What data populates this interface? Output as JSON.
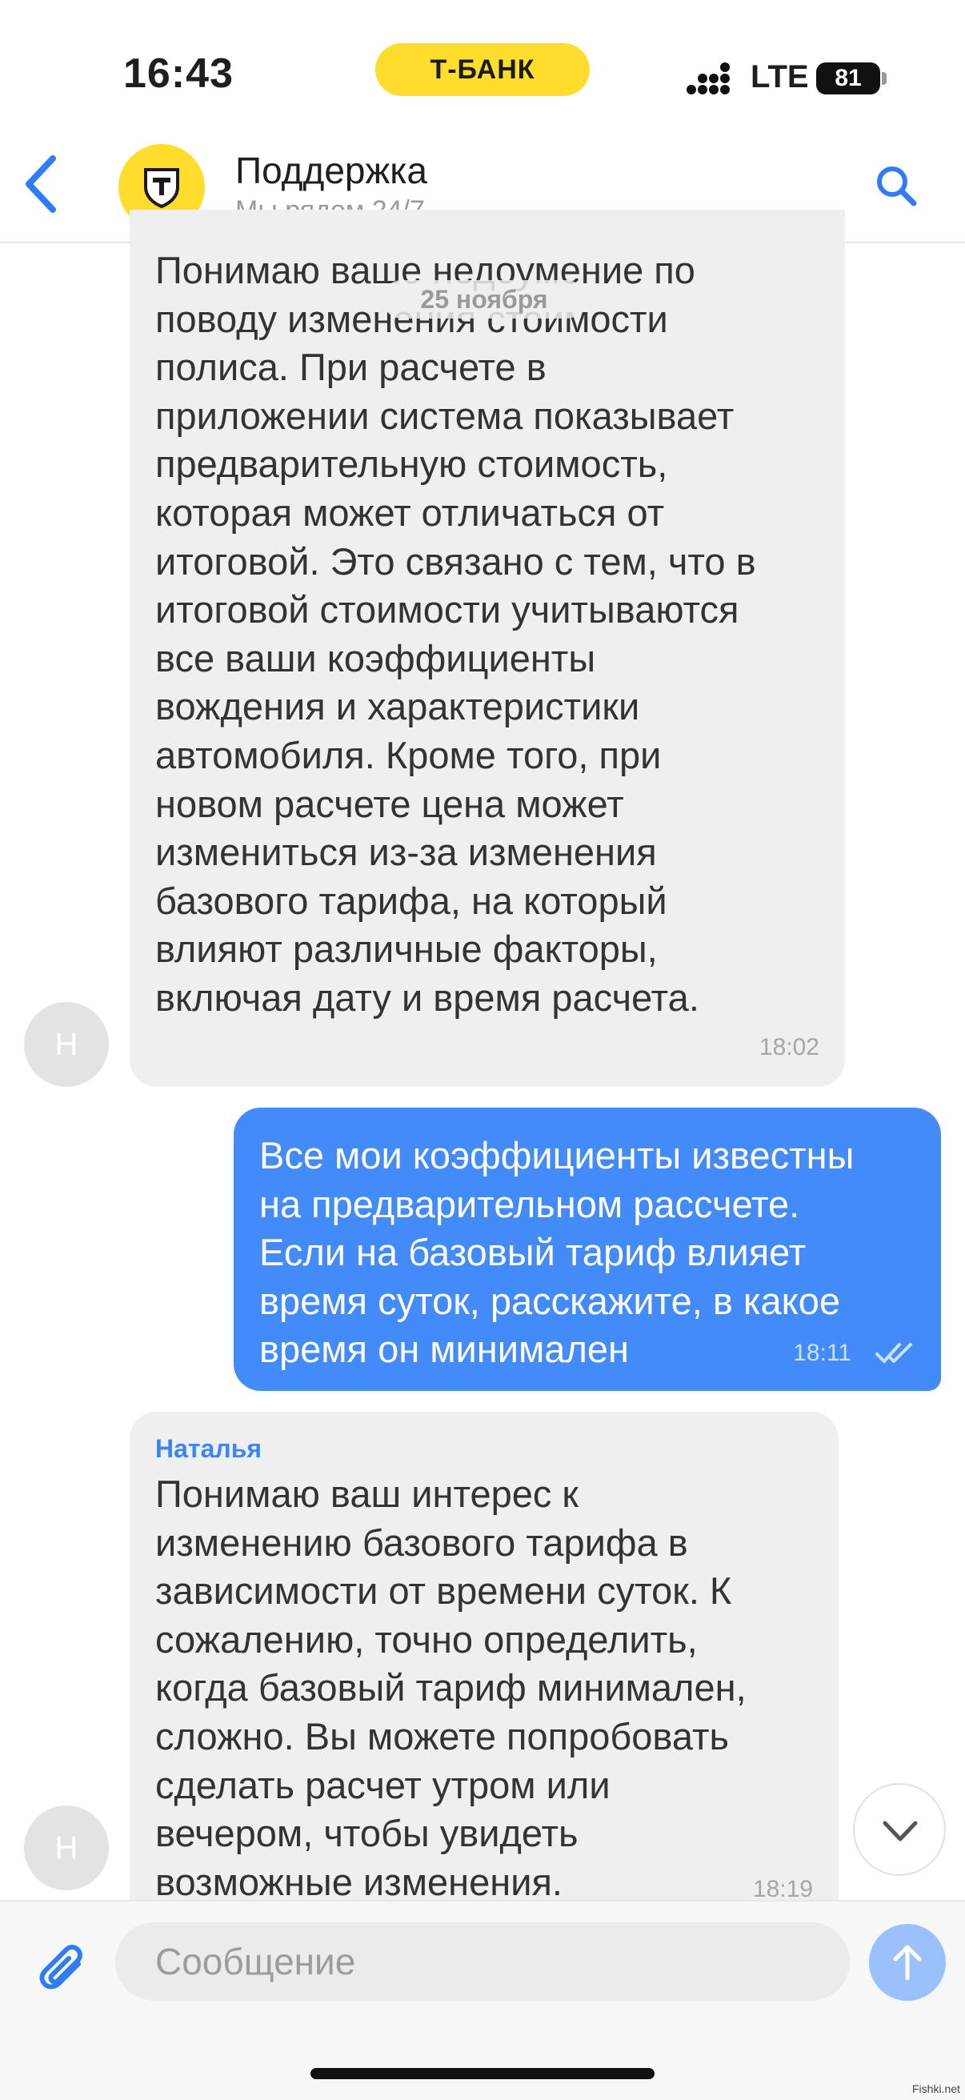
{
  "status_bar": {
    "time": "16:43",
    "carrier_badge": "Т-БАНК",
    "network": "LTE",
    "battery": "81"
  },
  "header": {
    "title": "Поддержка",
    "subtitle": "Мы рядом 24/7",
    "back_icon": "chevron-left-icon",
    "search_icon": "search-icon",
    "logo_icon": "tbank-shield-icon"
  },
  "chat": {
    "date_separator": "25 ноября",
    "messages": [
      {
        "direction": "incoming",
        "avatar": "Н",
        "sender": "",
        "text": "Понимаю ваше недоумение по\nповоду изменения стоимости\nполиса. При расчете в\nприложении система показывает\nпредварительную стоимость,\nкоторая может отличаться от\nитоговой. Это связано с тем, что в\nитоговой стоимости учитываются\nвсе ваши коэффициенты\nвождения и характеристики\nавтомобиля. Кроме того, при\nновом расчете цена может\nизмениться из-за изменения\nбазового тарифа, на который\nвлияют различные факторы,\nвключая дату и время расчета.",
        "time": "18:02"
      },
      {
        "direction": "outgoing",
        "text": "Все мои коэффициенты известны\nна предварительном рассчете.\nЕсли на базовый тариф влияет\nвремя суток, расскажите, в какое\nвремя он минимален",
        "time": "18:11",
        "status_icon": "double-check-icon"
      },
      {
        "direction": "incoming",
        "avatar": "Н",
        "sender": "Наталья",
        "text": "Понимаю ваш интерес к\nизменению базового тарифа в\nзависимости от времени суток. К\nсожалению, точно определить,\nкогда базовый тариф минимален,\nсложно. Вы можете попробовать\nсделать расчет утром или\nвечером, чтобы увидеть\nвозможные изменения.",
        "time": "18:19"
      }
    ]
  },
  "composer": {
    "placeholder": "Сообщение",
    "attach_icon": "paperclip-icon",
    "send_icon": "arrow-up-icon"
  },
  "scroll_down_icon": "chevron-down-icon",
  "watermark": "Fishki.net",
  "colors": {
    "accent_blue": "#428bf9",
    "brand_yellow": "#ffdd2d",
    "incoming_bubble": "#efefef"
  }
}
